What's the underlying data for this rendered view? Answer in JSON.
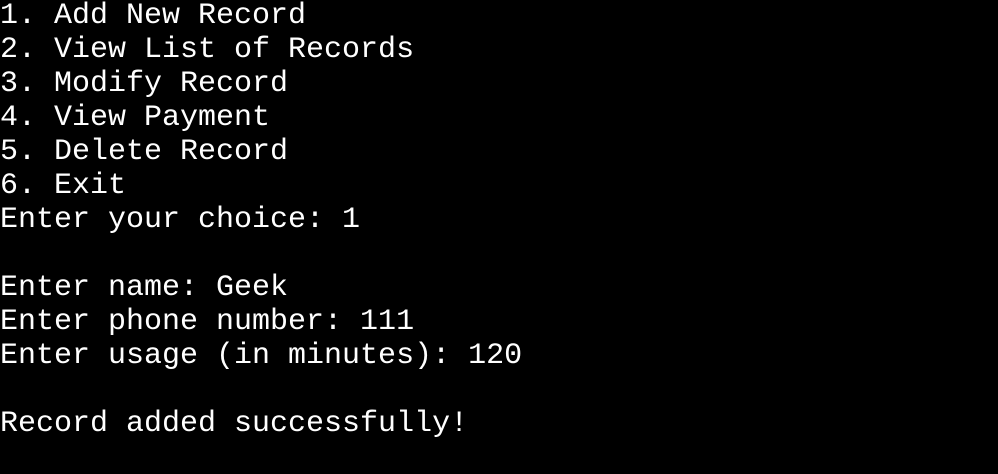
{
  "terminal": {
    "background": "#000000",
    "foreground": "#ffffff",
    "lines": [
      "1. Add New Record",
      "2. View List of Records",
      "3. Modify Record",
      "4. View Payment",
      "5. Delete Record",
      "6. Exit",
      "Enter your choice: 1",
      "",
      "Enter name: Geek",
      "Enter phone number: 111",
      "Enter usage (in minutes): 120",
      "",
      "Record added successfully!"
    ]
  }
}
